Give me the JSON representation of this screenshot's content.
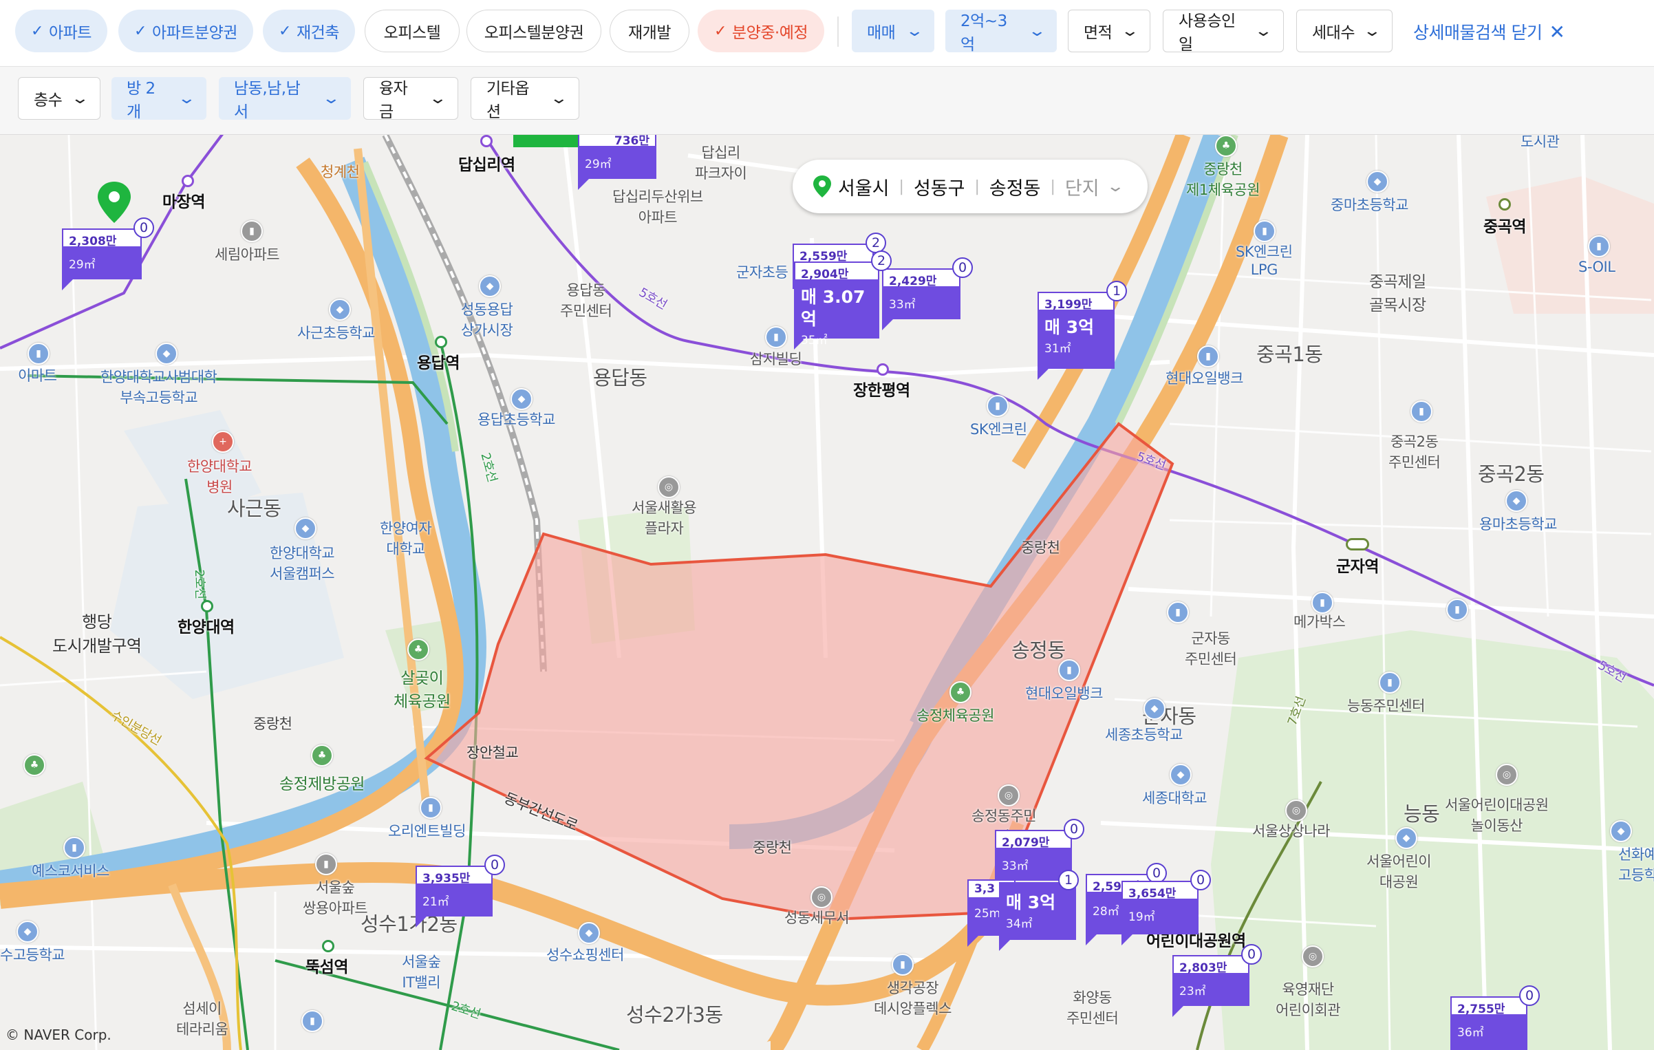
{
  "filters_row1": {
    "chips": [
      {
        "label": "아파트",
        "active": true
      },
      {
        "label": "아파트분양권",
        "active": true
      },
      {
        "label": "재건축",
        "active": true
      },
      {
        "label": "오피스텔",
        "active": false
      },
      {
        "label": "오피스텔분양권",
        "active": false
      },
      {
        "label": "재개발",
        "active": false
      },
      {
        "label": "분양중·예정",
        "active": true
      }
    ],
    "dropdowns": [
      {
        "label": "매매",
        "active": true
      },
      {
        "label": "2억~3억",
        "active": true
      },
      {
        "label": "면적",
        "active": false
      },
      {
        "label": "사용승인일",
        "active": false
      },
      {
        "label": "세대수",
        "active": false
      }
    ],
    "close_label": "상세매물검색 닫기",
    "check_glyph": "✓",
    "chevron_glyph": "⌄",
    "close_glyph": "✕"
  },
  "filters_row2": {
    "dropdowns": [
      {
        "label": "층수",
        "active": false
      },
      {
        "label": "방 2개",
        "active": true
      },
      {
        "label": "남동,남,남서",
        "active": true
      },
      {
        "label": "융자금",
        "active": false
      },
      {
        "label": "기타옵션",
        "active": false
      }
    ]
  },
  "breadcrumb": {
    "city": "서울시",
    "district": "성동구",
    "dong": "송정동",
    "complex": "단지"
  },
  "colors": {
    "accent_blue": "#2e6fd8",
    "marker_purple": "#6f4ce0",
    "selection_red": "#e8563e",
    "river": "#8fc3e8",
    "road_orange": "#f4b66a"
  },
  "map_labels": {
    "districts": [
      "용답동",
      "사근동",
      "성수1가2동",
      "성수2가3동",
      "송정동",
      "중곡1동",
      "중곡2동",
      "능동",
      "행당\n도시개발구역",
      "군자동"
    ],
    "stations": [
      "마장역",
      "답십리역",
      "용답역",
      "장한평역",
      "한양대역",
      "뚝섬역",
      "군자역",
      "중곡역",
      "어린이대공원역"
    ],
    "places": [
      "세림아파트",
      "성동용답\n상가시장",
      "용답동\n주민센터",
      "사근초등학교",
      "한양대학교사범대학\n부속고등학교",
      "한양대학교\n병원",
      "한양여자\n대학교",
      "한양대학교\n서울캠퍼스",
      "용답초등학교",
      "서울새활용\n플라자",
      "삼지빌딩",
      "SK엔크린",
      "살곶이\n체육공원",
      "송정제방공원",
      "오리엔트빌딩",
      "서울숲\n쌍용아파트",
      "서울숲\nIT밸리",
      "성수쇼핑센터",
      "섬세이\n테라리움",
      "송정체육공원",
      "현대오일뱅크",
      "송정동주민\n자",
      "성동세무서",
      "생각공장\n데시앙플렉스",
      "화양동\n주민센터",
      "육영재단\n어린이회관",
      "서울어린이\n대공원",
      "서울어린이대공원\n놀이동산",
      "세종대학교",
      "세종초등학교",
      "군자동\n주민센터",
      "메가박스",
      "능동주민센터",
      "중곡2동\n주민센터",
      "용마초등학교",
      "중곡제일\n골목시장",
      "SK엔크린\nLPG",
      "중마초등학교",
      "중랑천\n제1체육공원",
      "답십리두산위브\n아파트",
      "답십리\n파크자이",
      "현대오일뱅크",
      "S-OIL",
      "선화예술\n고등학교",
      "서울상상나라",
      "이마트",
      "예스코서비스",
      "수고등학교",
      "도시관",
      "방서",
      "군자초등"
    ],
    "roads": [
      "청계천",
      "중랑천",
      "중랑천",
      "중랑천",
      "동부간선도로",
      "장안철교",
      "5호선",
      "5호선",
      "5호선",
      "2호선",
      "2호선",
      "2호선",
      "7호선",
      "수인분당선"
    ],
    "copyright": "© NAVER Corp."
  },
  "markers": [
    {
      "count": "0",
      "price_top": "2,308만",
      "main": "",
      "area": "29㎡"
    },
    {
      "count": "",
      "price_top": "736만",
      "main": "",
      "area": "29㎡"
    },
    {
      "count": "2",
      "price_top": "2,559만",
      "main": "",
      "area": ""
    },
    {
      "count": "2",
      "price_top": "2,904만",
      "main": "매 3.07억",
      "area": "35㎡"
    },
    {
      "count": "0",
      "price_top": "2,429만",
      "main": "",
      "area": "33㎡"
    },
    {
      "count": "1",
      "price_top": "3,199만",
      "main": "매 3억",
      "area": "31㎡"
    },
    {
      "count": "0",
      "price_top": "3,935만",
      "main": "",
      "area": "21㎡"
    },
    {
      "count": "0",
      "price_top": "2,079만",
      "main": "",
      "area": "33㎡"
    },
    {
      "count": "",
      "price_top": "3,3",
      "main": "",
      "area": "25m"
    },
    {
      "count": "1",
      "price_top": "",
      "main": "매 3억",
      "area": "34㎡"
    },
    {
      "count": "0",
      "price_top": "2,597만",
      "main": "",
      "area": "28㎡"
    },
    {
      "count": "0",
      "price_top": "3,654만",
      "main": "",
      "area": "19㎡"
    },
    {
      "count": "0",
      "price_top": "2,803만",
      "main": "",
      "area": "23㎡"
    },
    {
      "count": "0",
      "price_top": "2,755만",
      "main": "",
      "area": "36㎡"
    }
  ]
}
